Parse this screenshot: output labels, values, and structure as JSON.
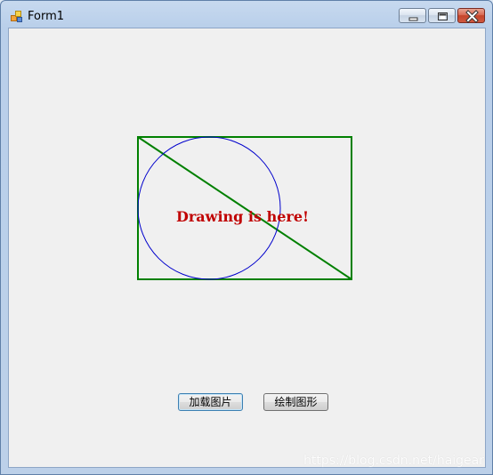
{
  "window": {
    "title": "Form1",
    "controls": {
      "minimize": "minimize",
      "maximize": "maximize",
      "close": "close"
    }
  },
  "canvas": {
    "text": "Drawing is here!",
    "colors": {
      "rect": "#008000",
      "diagonal": "#008000",
      "circle": "#0000cc",
      "text": "#c00000"
    }
  },
  "buttons": {
    "load_image": "加载图片",
    "draw_shape": "绘制图形"
  },
  "watermark": "https://blog.csdn.net/haigear"
}
